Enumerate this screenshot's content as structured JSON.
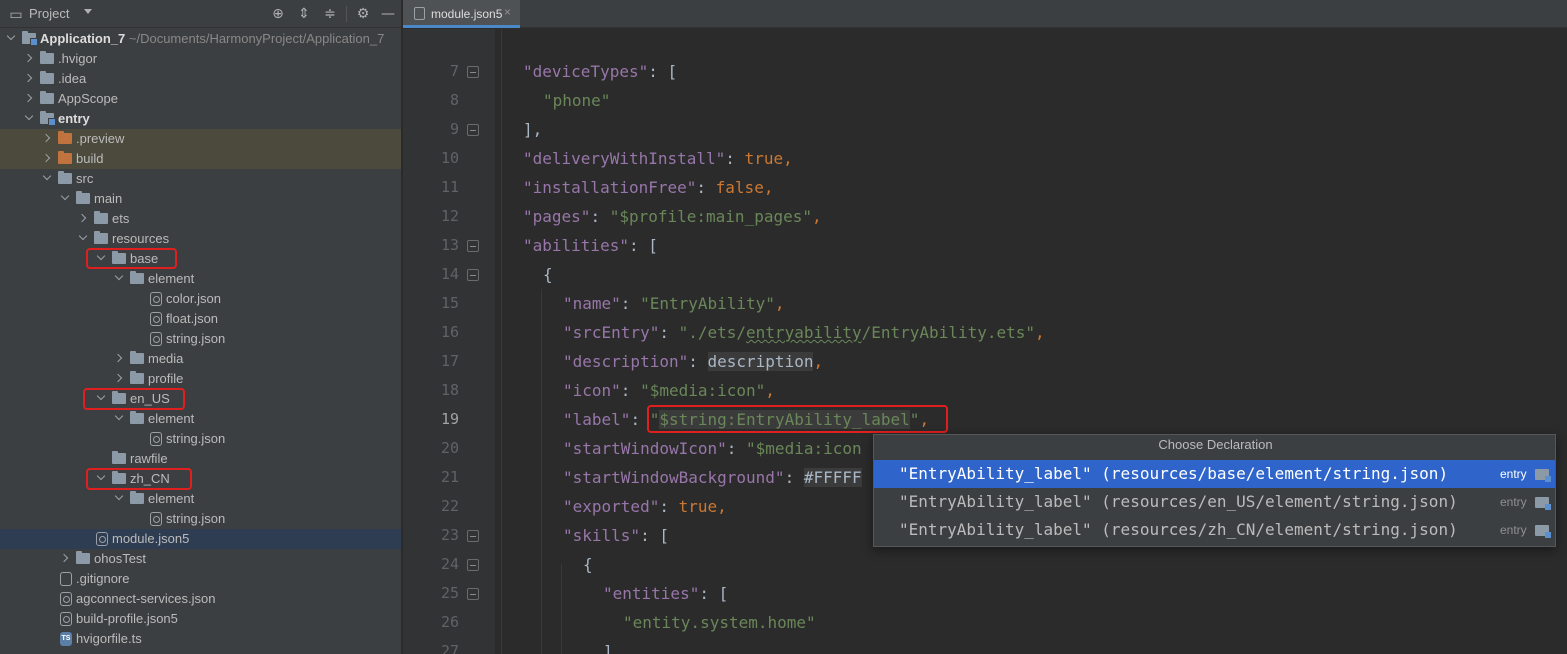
{
  "project_panel": {
    "title": "Project",
    "tree": [
      {
        "label": "Application_7",
        "path": "~/Documents/HarmonyProject/Application_7"
      },
      {
        "label": ".hvigor"
      },
      {
        "label": ".idea"
      },
      {
        "label": "AppScope"
      },
      {
        "label": "entry"
      },
      {
        "label": ".preview"
      },
      {
        "label": "build"
      },
      {
        "label": "src"
      },
      {
        "label": "main"
      },
      {
        "label": "ets"
      },
      {
        "label": "resources"
      },
      {
        "label": "base"
      },
      {
        "label": "element"
      },
      {
        "label": "color.json"
      },
      {
        "label": "float.json"
      },
      {
        "label": "string.json"
      },
      {
        "label": "media"
      },
      {
        "label": "profile"
      },
      {
        "label": "en_US"
      },
      {
        "label": "element"
      },
      {
        "label": "string.json"
      },
      {
        "label": "rawfile"
      },
      {
        "label": "zh_CN"
      },
      {
        "label": "element"
      },
      {
        "label": "string.json"
      },
      {
        "label": "module.json5"
      },
      {
        "label": "ohosTest"
      },
      {
        "label": ".gitignore"
      },
      {
        "label": "agconnect-services.json"
      },
      {
        "label": "build-profile.json5"
      },
      {
        "label": "hvigorfile.ts"
      }
    ]
  },
  "editor": {
    "tab_label": "module.json5",
    "tab_close": "×",
    "line_numbers": [
      "7",
      "8",
      "9",
      "10",
      "11",
      "12",
      "13",
      "14",
      "15",
      "16",
      "17",
      "18",
      "19",
      "20",
      "21",
      "22",
      "23",
      "24",
      "25",
      "26",
      "27"
    ],
    "lines": {
      "l7": {
        "key": "\"deviceTypes\"",
        "rest": ": ["
      },
      "l8": {
        "val": "\"phone\""
      },
      "l9": {
        "text": "],"
      },
      "l10": {
        "key": "\"deliveryWithInstall\"",
        "colon": ": ",
        "val": "true",
        "end": ","
      },
      "l11": {
        "key": "\"installationFree\"",
        "colon": ": ",
        "val": "false",
        "end": ","
      },
      "l12": {
        "key": "\"pages\"",
        "colon": ": ",
        "val": "\"$profile:main_pages\"",
        "end": ","
      },
      "l13": {
        "key": "\"abilities\"",
        "rest": ": ["
      },
      "l14": {
        "text": "{"
      },
      "l15": {
        "key": "\"name\"",
        "colon": ": ",
        "val": "\"EntryAbility\"",
        "end": ","
      },
      "l16": {
        "key": "\"srcEntry\"",
        "colon": ": ",
        "val_a": "\"./ets/",
        "val_b": "entryability",
        "val_c": "/EntryAbility.ets\"",
        "end": ","
      },
      "l17": {
        "key": "\"description\"",
        "colon": ": ",
        "val": "description",
        "end": ","
      },
      "l18": {
        "key": "\"icon\"",
        "colon": ": ",
        "val": "\"$media:icon\"",
        "end": ","
      },
      "l19": {
        "key": "\"label\"",
        "colon": ": ",
        "q": "\"",
        "val": "$string:EntryAbility_label",
        "q2": "\"",
        "end": ","
      },
      "l20": {
        "key": "\"startWindowIcon\"",
        "colon": ": ",
        "val": "\"$media:icon"
      },
      "l21": {
        "key": "\"startWindowBackground\"",
        "colon": ": ",
        "val": "#FFFFF"
      },
      "l22": {
        "key": "\"exported\"",
        "colon": ": ",
        "val": "true",
        "end": ","
      },
      "l23": {
        "key": "\"skills\"",
        "rest": ": ["
      },
      "l24": {
        "text": "{"
      },
      "l25": {
        "key": "\"entities\"",
        "rest": ": ["
      },
      "l26": {
        "val": "\"entity.system.home\""
      },
      "l27": {
        "text": "]"
      }
    }
  },
  "popup": {
    "title": "Choose Declaration",
    "items": [
      {
        "text": "\"EntryAbility_label\" (resources/base/element/string.json)",
        "module": "entry"
      },
      {
        "text": "\"EntryAbility_label\" (resources/en_US/element/string.json)",
        "module": "entry"
      },
      {
        "text": "\"EntryAbility_label\" (resources/zh_CN/element/string.json)",
        "module": "entry"
      }
    ]
  },
  "colors": {
    "highlight_box": "#e0201e",
    "selection": "#2f65ca",
    "keyword": "#9876aa",
    "string": "#6a8759",
    "literal": "#cc7832"
  }
}
